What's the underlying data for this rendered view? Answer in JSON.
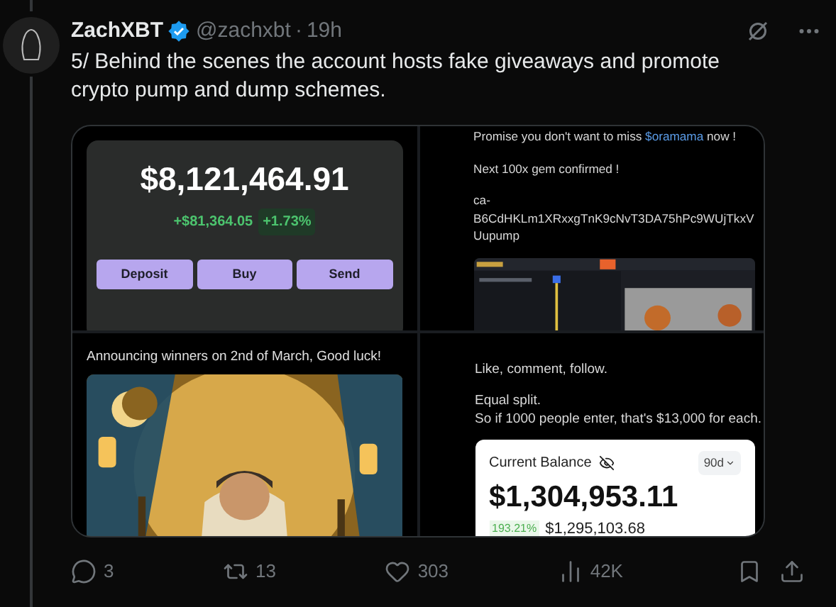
{
  "post": {
    "author": "ZachXBT",
    "handle": "@zachxbt",
    "separator": "·",
    "time": "19h",
    "text": "5/ Behind the scenes the account hosts fake giveaways and promote crypto pump and dump schemes."
  },
  "media": [
    {
      "kind": "wallet",
      "balance": "$8,121,464.91",
      "change": "+$81,364.05",
      "change_pct": "+1.73%",
      "buttons": [
        "Deposit",
        "Buy",
        "Send"
      ]
    },
    {
      "kind": "post",
      "first_line": {
        "before": "Promise you don't want to miss ",
        "link": "$oramama",
        "after": " now !"
      },
      "paragraphs": [
        [
          "Next 100x gem confirmed !"
        ],
        [
          "ca-",
          "B6CdHKLm1XRxxgTnK9cNvT3DA75hPc9WUjTkxV",
          "Uupump"
        ]
      ],
      "embed": {
        "kind": "picture"
      }
    },
    {
      "kind": "announcement",
      "caption": "Announcing winners on 2nd of March, Good luck!",
      "image": {
        "kind": "picture"
      }
    },
    {
      "kind": "balance",
      "paragraphs": [
        [
          "Like, comment, follow."
        ],
        [
          "Equal split.",
          "So if 1000 people enter, that's $13,000 for each."
        ]
      ],
      "card_title": "Current Balance",
      "period": "90d",
      "balance": "$1,304,953.11",
      "gain_pct": "193.21%",
      "gain": "$1,295,103.68"
    }
  ],
  "actions": [
    {
      "kind": "reply",
      "count": "3"
    },
    {
      "kind": "repost",
      "count": "13"
    },
    {
      "kind": "like",
      "count": "303"
    },
    {
      "kind": "views",
      "count": "42K"
    },
    {
      "kind": "bookmark"
    },
    {
      "kind": "share"
    }
  ]
}
